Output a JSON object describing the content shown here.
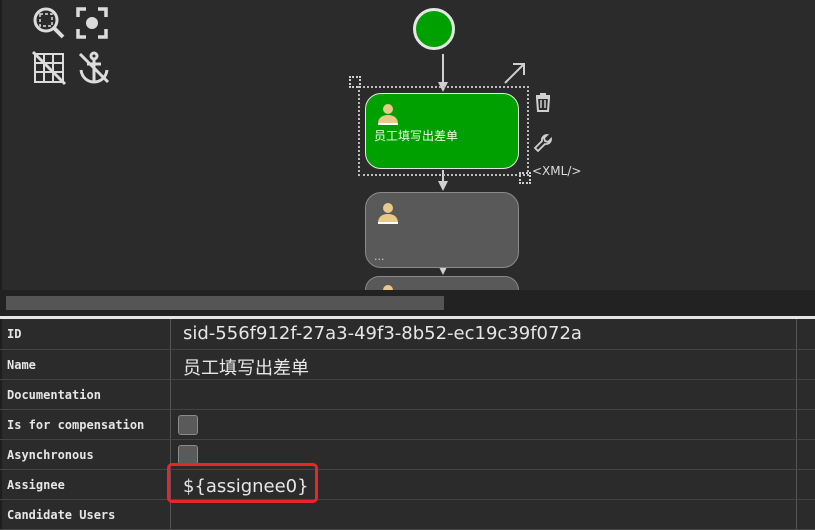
{
  "toolbar": {
    "icons": [
      "zoom-icon",
      "fit-icon",
      "grid-icon",
      "anchor-icon"
    ]
  },
  "diagram": {
    "active_task_label": "员工填写出差单",
    "second_task_dots": "...",
    "xml_label": "<XML/>",
    "active_color": "#00a000",
    "inactive_color": "#595959"
  },
  "properties": {
    "rows": [
      {
        "name": "ID",
        "value": "sid-556f912f-27a3-49f3-8b52-ec19c39f072a"
      },
      {
        "name": "Name",
        "value": "员工填写出差单"
      },
      {
        "name": "Documentation",
        "value": ""
      },
      {
        "name": "Is for compensation",
        "value": ""
      },
      {
        "name": "Asynchronous",
        "value": ""
      },
      {
        "name": "Assignee",
        "value": "${assignee0}"
      },
      {
        "name": "Candidate Users",
        "value": ""
      }
    ]
  },
  "highlight_color": "#e8262a"
}
